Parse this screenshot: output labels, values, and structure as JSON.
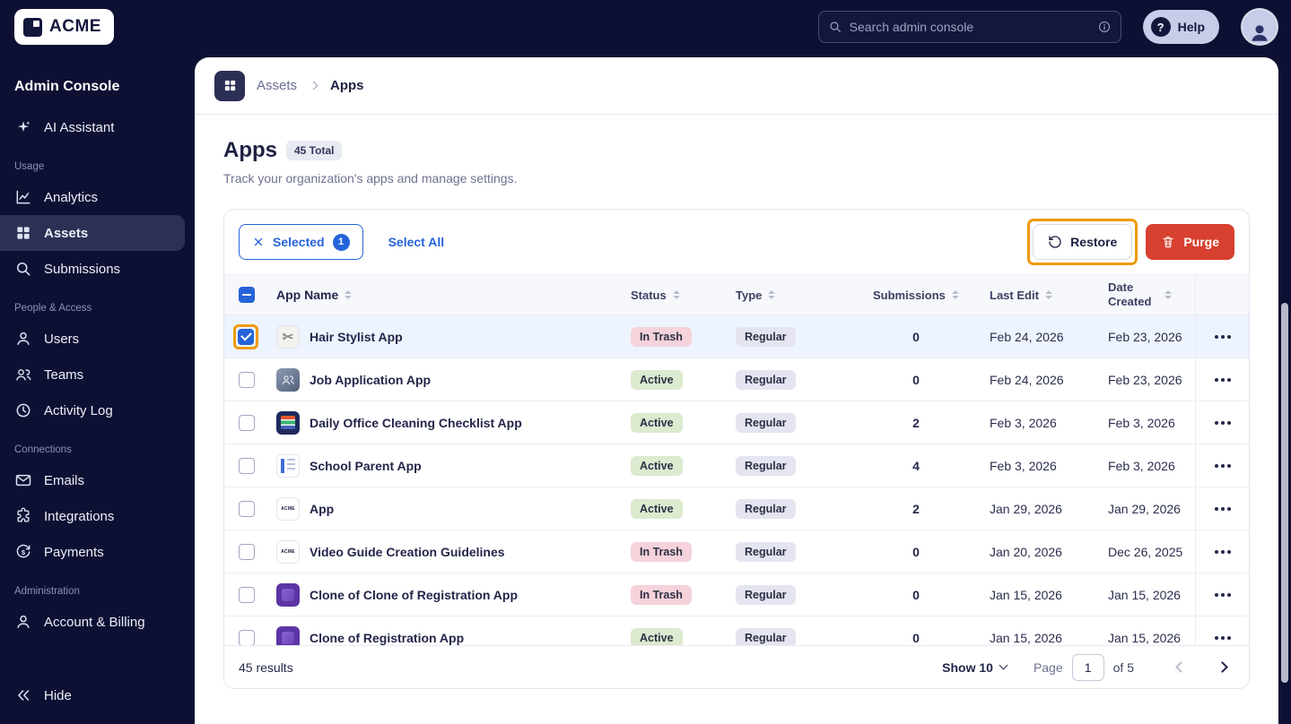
{
  "topbar": {
    "brand": "ACME",
    "search_placeholder": "Search admin console",
    "help": "Help"
  },
  "sidebar": {
    "title": "Admin Console",
    "ai_assistant": "AI Assistant",
    "section_usage": "Usage",
    "analytics": "Analytics",
    "assets": "Assets",
    "submissions": "Submissions",
    "section_people": "People & Access",
    "users": "Users",
    "teams": "Teams",
    "activity_log": "Activity Log",
    "section_connections": "Connections",
    "emails": "Emails",
    "integrations": "Integrations",
    "payments": "Payments",
    "section_admin": "Administration",
    "account_billing": "Account & Billing",
    "hide": "Hide"
  },
  "breadcrumb": {
    "section": "Assets",
    "current": "Apps"
  },
  "page": {
    "title": "Apps",
    "total_badge": "45 Total",
    "subtitle": "Track your organization's apps and manage settings."
  },
  "toolbar": {
    "selected_label": "Selected",
    "selected_count": "1",
    "select_all": "Select All",
    "restore": "Restore",
    "purge": "Purge"
  },
  "table": {
    "columns": {
      "app_name": "App Name",
      "status": "Status",
      "type": "Type",
      "submissions": "Submissions",
      "last_edit": "Last Edit",
      "date_created": "Date Created"
    },
    "rows": [
      {
        "name": "Hair Stylist App",
        "icon": "hair-stylist-thumbnail",
        "status": "In Trash",
        "type": "Regular",
        "submissions": "0",
        "last_edit": "Feb 24, 2026",
        "date_created": "Feb 23, 2026",
        "selected": true
      },
      {
        "name": "Job Application App",
        "icon": "job-application-thumbnail",
        "status": "Active",
        "type": "Regular",
        "submissions": "0",
        "last_edit": "Feb 24, 2026",
        "date_created": "Feb 23, 2026",
        "selected": false
      },
      {
        "name": "Daily Office Cleaning Checklist App",
        "icon": "cleaning-checklist-thumbnail",
        "status": "Active",
        "type": "Regular",
        "submissions": "2",
        "last_edit": "Feb 3, 2026",
        "date_created": "Feb 3, 2026",
        "selected": false
      },
      {
        "name": "School Parent App",
        "icon": "school-parent-thumbnail",
        "status": "Active",
        "type": "Regular",
        "submissions": "4",
        "last_edit": "Feb 3, 2026",
        "date_created": "Feb 3, 2026",
        "selected": false
      },
      {
        "name": "App",
        "icon": "acme-logo-thumbnail",
        "status": "Active",
        "type": "Regular",
        "submissions": "2",
        "last_edit": "Jan 29, 2026",
        "date_created": "Jan 29, 2026",
        "selected": false
      },
      {
        "name": "Video Guide Creation Guidelines",
        "icon": "acme-logo-thumbnail",
        "status": "In Trash",
        "type": "Regular",
        "submissions": "0",
        "last_edit": "Jan 20, 2026",
        "date_created": "Dec 26, 2025",
        "selected": false
      },
      {
        "name": "Clone of Clone of Registration App",
        "icon": "registration-app-thumbnail",
        "status": "In Trash",
        "type": "Regular",
        "submissions": "0",
        "last_edit": "Jan 15, 2026",
        "date_created": "Jan 15, 2026",
        "selected": false
      },
      {
        "name": "Clone of Registration App",
        "icon": "registration-app-thumbnail",
        "status": "Active",
        "type": "Regular",
        "submissions": "0",
        "last_edit": "Jan 15, 2026",
        "date_created": "Jan 15, 2026",
        "selected": false
      }
    ]
  },
  "footer": {
    "results": "45 results",
    "show": "Show 10",
    "page_label": "Page",
    "page_value": "1",
    "of_label": "of 5"
  },
  "colors": {
    "topbar_bg": "#0d1033",
    "accent_blue": "#2563d9",
    "purge_red": "#d8402f",
    "annotation_orange": "#ef9a0e",
    "badge_trash_bg": "#f6d2da",
    "badge_active_bg": "#dcead0",
    "badge_type_bg": "#e4e5f0",
    "selected_row_bg": "#eef4ff"
  }
}
